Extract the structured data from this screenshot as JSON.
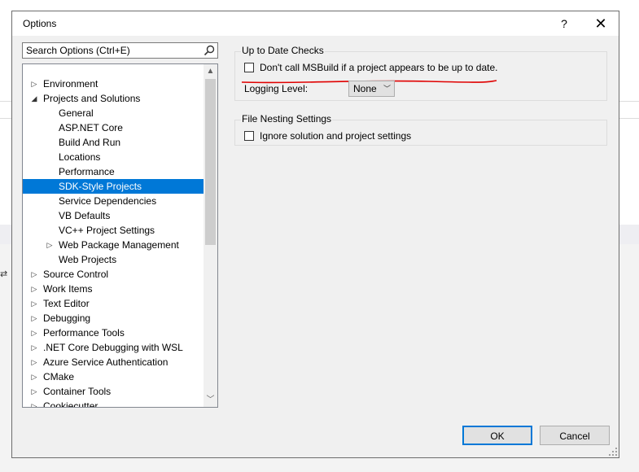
{
  "dialog": {
    "title": "Options",
    "help": "?",
    "close": "✕"
  },
  "search": {
    "placeholder": "Search Options (Ctrl+E)"
  },
  "tree": {
    "items": [
      {
        "label": "Environment",
        "expander": "collapsed",
        "level": 0
      },
      {
        "label": "Projects and Solutions",
        "expander": "expanded",
        "level": 0
      },
      {
        "label": "General",
        "expander": "none",
        "level": 1
      },
      {
        "label": "ASP.NET Core",
        "expander": "none",
        "level": 1
      },
      {
        "label": "Build And Run",
        "expander": "none",
        "level": 1
      },
      {
        "label": "Locations",
        "expander": "none",
        "level": 1
      },
      {
        "label": "Performance",
        "expander": "none",
        "level": 1
      },
      {
        "label": "SDK-Style Projects",
        "expander": "none",
        "level": 1,
        "selected": true
      },
      {
        "label": "Service Dependencies",
        "expander": "none",
        "level": 1
      },
      {
        "label": "VB Defaults",
        "expander": "none",
        "level": 1
      },
      {
        "label": "VC++ Project Settings",
        "expander": "none",
        "level": 1
      },
      {
        "label": "Web Package Management",
        "expander": "collapsed",
        "level": 1
      },
      {
        "label": "Web Projects",
        "expander": "none",
        "level": 1
      },
      {
        "label": "Source Control",
        "expander": "collapsed",
        "level": 0
      },
      {
        "label": "Work Items",
        "expander": "collapsed",
        "level": 0
      },
      {
        "label": "Text Editor",
        "expander": "collapsed",
        "level": 0
      },
      {
        "label": "Debugging",
        "expander": "collapsed",
        "level": 0
      },
      {
        "label": "Performance Tools",
        "expander": "collapsed",
        "level": 0
      },
      {
        "label": ".NET Core Debugging with WSL",
        "expander": "collapsed",
        "level": 0
      },
      {
        "label": "Azure Service Authentication",
        "expander": "collapsed",
        "level": 0
      },
      {
        "label": "CMake",
        "expander": "collapsed",
        "level": 0
      },
      {
        "label": "Container Tools",
        "expander": "collapsed",
        "level": 0
      },
      {
        "label": "Cookiecutter",
        "expander": "collapsed",
        "level": 0
      }
    ],
    "selected_color": "#0078d7"
  },
  "up_to_date": {
    "title": "Up to Date Checks",
    "checkbox_label": "Don't call MSBuild if a project appears to be up to date.",
    "checked": false,
    "logging_label": "Logging Level:",
    "logging_value": "None",
    "annotation_color": "#e00000"
  },
  "file_nesting": {
    "title": "File Nesting Settings",
    "checkbox_label": "Ignore solution and project settings",
    "checked": false
  },
  "buttons": {
    "ok": "OK",
    "cancel": "Cancel"
  }
}
